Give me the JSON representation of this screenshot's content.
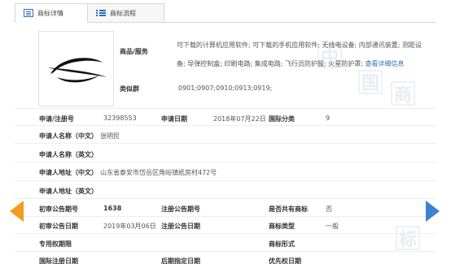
{
  "tabs": [
    {
      "label": "商标详情",
      "icon": "document-icon",
      "active": true
    },
    {
      "label": "商标流程",
      "icon": "list-icon",
      "active": false
    }
  ],
  "services": {
    "label": "商品/服务",
    "text": "可下载的计算机应用软件; 可下载的手机应用软件; 无线电设备; 内部通讯装置; 测距设备; 导弹控制盒; 印刷电路; 集成电路; 飞行员防护服; 火星防护罩;",
    "more_link": "查看详细信息"
  },
  "class_group": {
    "label": "类似群",
    "value": "0901;0907;0910;0913;0919;"
  },
  "fields": {
    "reg_no_label": "申请/注册号",
    "reg_no": "32398553",
    "app_date_label": "申请日期",
    "app_date": "2018年07月22日",
    "intl_class_label": "国际分类",
    "intl_class": "9",
    "applicant_cn_label": "申请人名称（中文）",
    "applicant_cn": "张明民",
    "applicant_en_label": "申请人名称（英文）",
    "applicant_en": "",
    "address_cn_label": "申请人地址（中文）",
    "address_cn": "山东省泰安市岱岳区角峪镇纸房村472号",
    "address_en_label": "申请人地址（英文）",
    "address_en": "",
    "prelim_no_label": "初审公告期号",
    "prelim_no": "1638",
    "reg_pub_no_label": "注册公告期号",
    "reg_pub_no": "",
    "shared_label": "是否共有商标",
    "shared": "否",
    "prelim_date_label": "初审公告日期",
    "prelim_date": "2019年03月06日",
    "reg_pub_date_label": "注册公告日期",
    "reg_pub_date": "",
    "tm_type_label": "商标类型",
    "tm_type": "一般",
    "exclusive_label": "专用权期限",
    "exclusive": "",
    "tm_form_label": "商标形式",
    "tm_form": "",
    "intl_reg_date_label": "国际注册日期",
    "intl_reg_date": "",
    "later_date_label": "后期指定日期",
    "later_date": "",
    "priority_date_label": "优先权日期",
    "priority_date": ""
  },
  "watermark": [
    "中",
    "国",
    "商",
    "标"
  ],
  "nav": {
    "prev_icon": "arrow-left-icon",
    "next_icon": "arrow-right-icon"
  },
  "colors": {
    "accent": "#2e6fb8",
    "prev_arrow": "#f39b1d",
    "next_arrow": "#3b83d1"
  }
}
